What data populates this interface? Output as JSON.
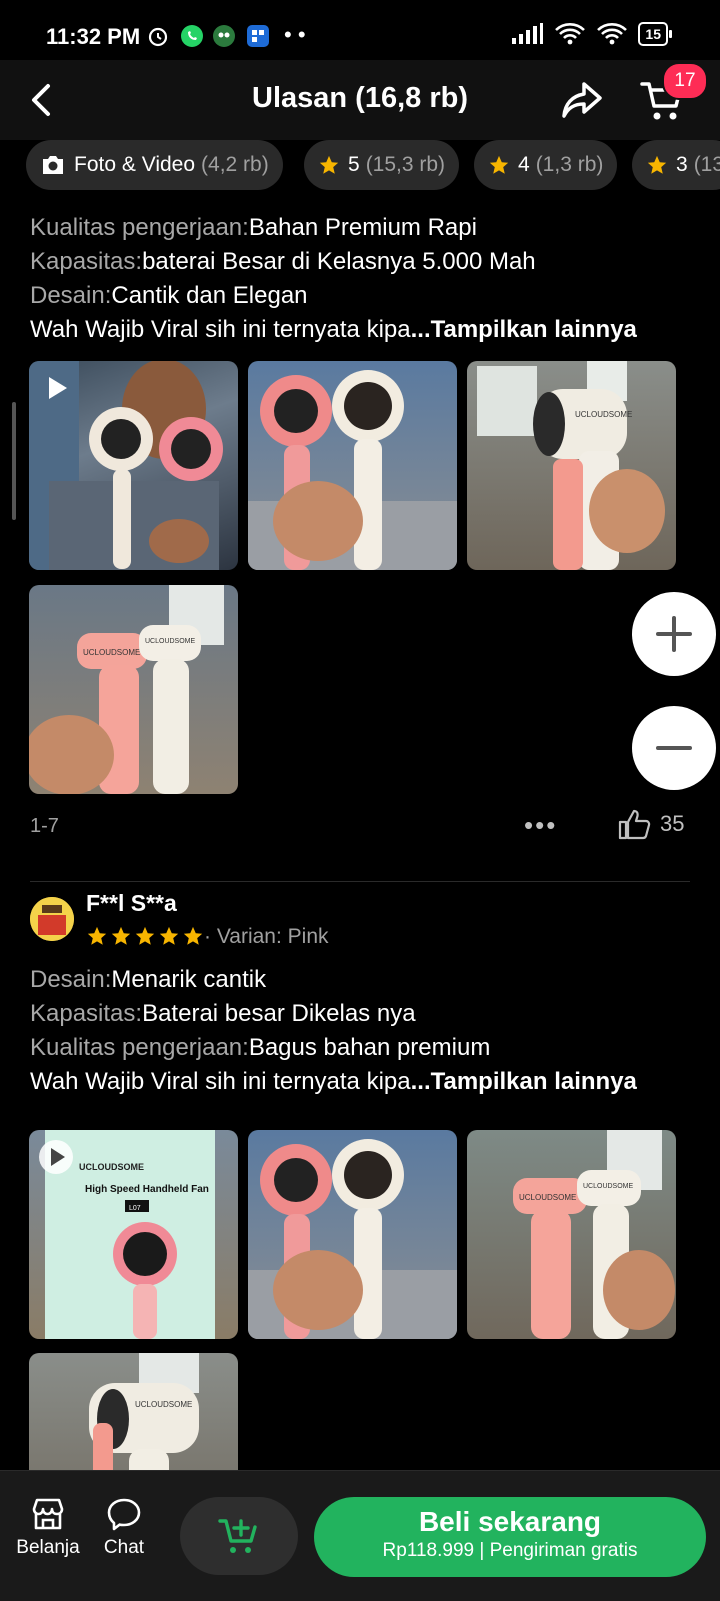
{
  "status": {
    "time": "11:32 PM",
    "battery": "15"
  },
  "header": {
    "title": "Ulasan (16,8 rb)",
    "cart_badge": "17"
  },
  "filters": [
    {
      "label": "Foto & Video",
      "count": "(4,2 rb)"
    },
    {
      "label": "5",
      "count": "(15,3 rb)"
    },
    {
      "label": "4",
      "count": "(1,3 rb)"
    },
    {
      "label": "3",
      "count": "(13"
    }
  ],
  "review1": {
    "lines": [
      {
        "key": "Kualitas pengerjaan:",
        "value": "Bahan Premium Rapi"
      },
      {
        "key": "Kapasitas:",
        "value": "baterai Besar di Kelasnya 5.000 Mah"
      },
      {
        "key": "Desain:",
        "value": "Cantik dan Elegan"
      }
    ],
    "body": "Wah Wajib Viral sih ini ternyata kipa",
    "more": "...Tampilkan lainnya",
    "photo_index": "1-7",
    "likes": "35"
  },
  "review2": {
    "user": "F**l S**a",
    "rating": 5,
    "variant": "Varian: Pink",
    "lines": [
      {
        "key": "Desain:",
        "value": "Menarik cantik"
      },
      {
        "key": "Kapasitas:",
        "value": "Baterai besar Dikelas nya"
      },
      {
        "key": "Kualitas pengerjaan:",
        "value": "Bagus bahan premium"
      }
    ],
    "body": "Wah Wajib Viral sih ini ternyata kipa",
    "more": "...Tampilkan lainnya"
  },
  "product_labels": {
    "brand": "UCLOUDSOME",
    "box_title": "High Speed Handheld Fan",
    "model": "L07"
  },
  "bottom": {
    "shop_label": "Belanja",
    "chat_label": "Chat",
    "buy_label": "Beli sekarang",
    "price": "Rp118.999",
    "shipping": "Pengiriman gratis"
  },
  "colors": {
    "accent_green": "#22b35e",
    "badge_red": "#fe2c55",
    "star": "#f7b500"
  },
  "icons": [
    "back-arrow-icon",
    "share-icon",
    "cart-icon",
    "camera-icon",
    "star-icon",
    "play-icon",
    "like-icon",
    "zoom-in-icon",
    "zoom-out-icon",
    "shop-icon",
    "chat-icon",
    "add-to-cart-icon"
  ]
}
